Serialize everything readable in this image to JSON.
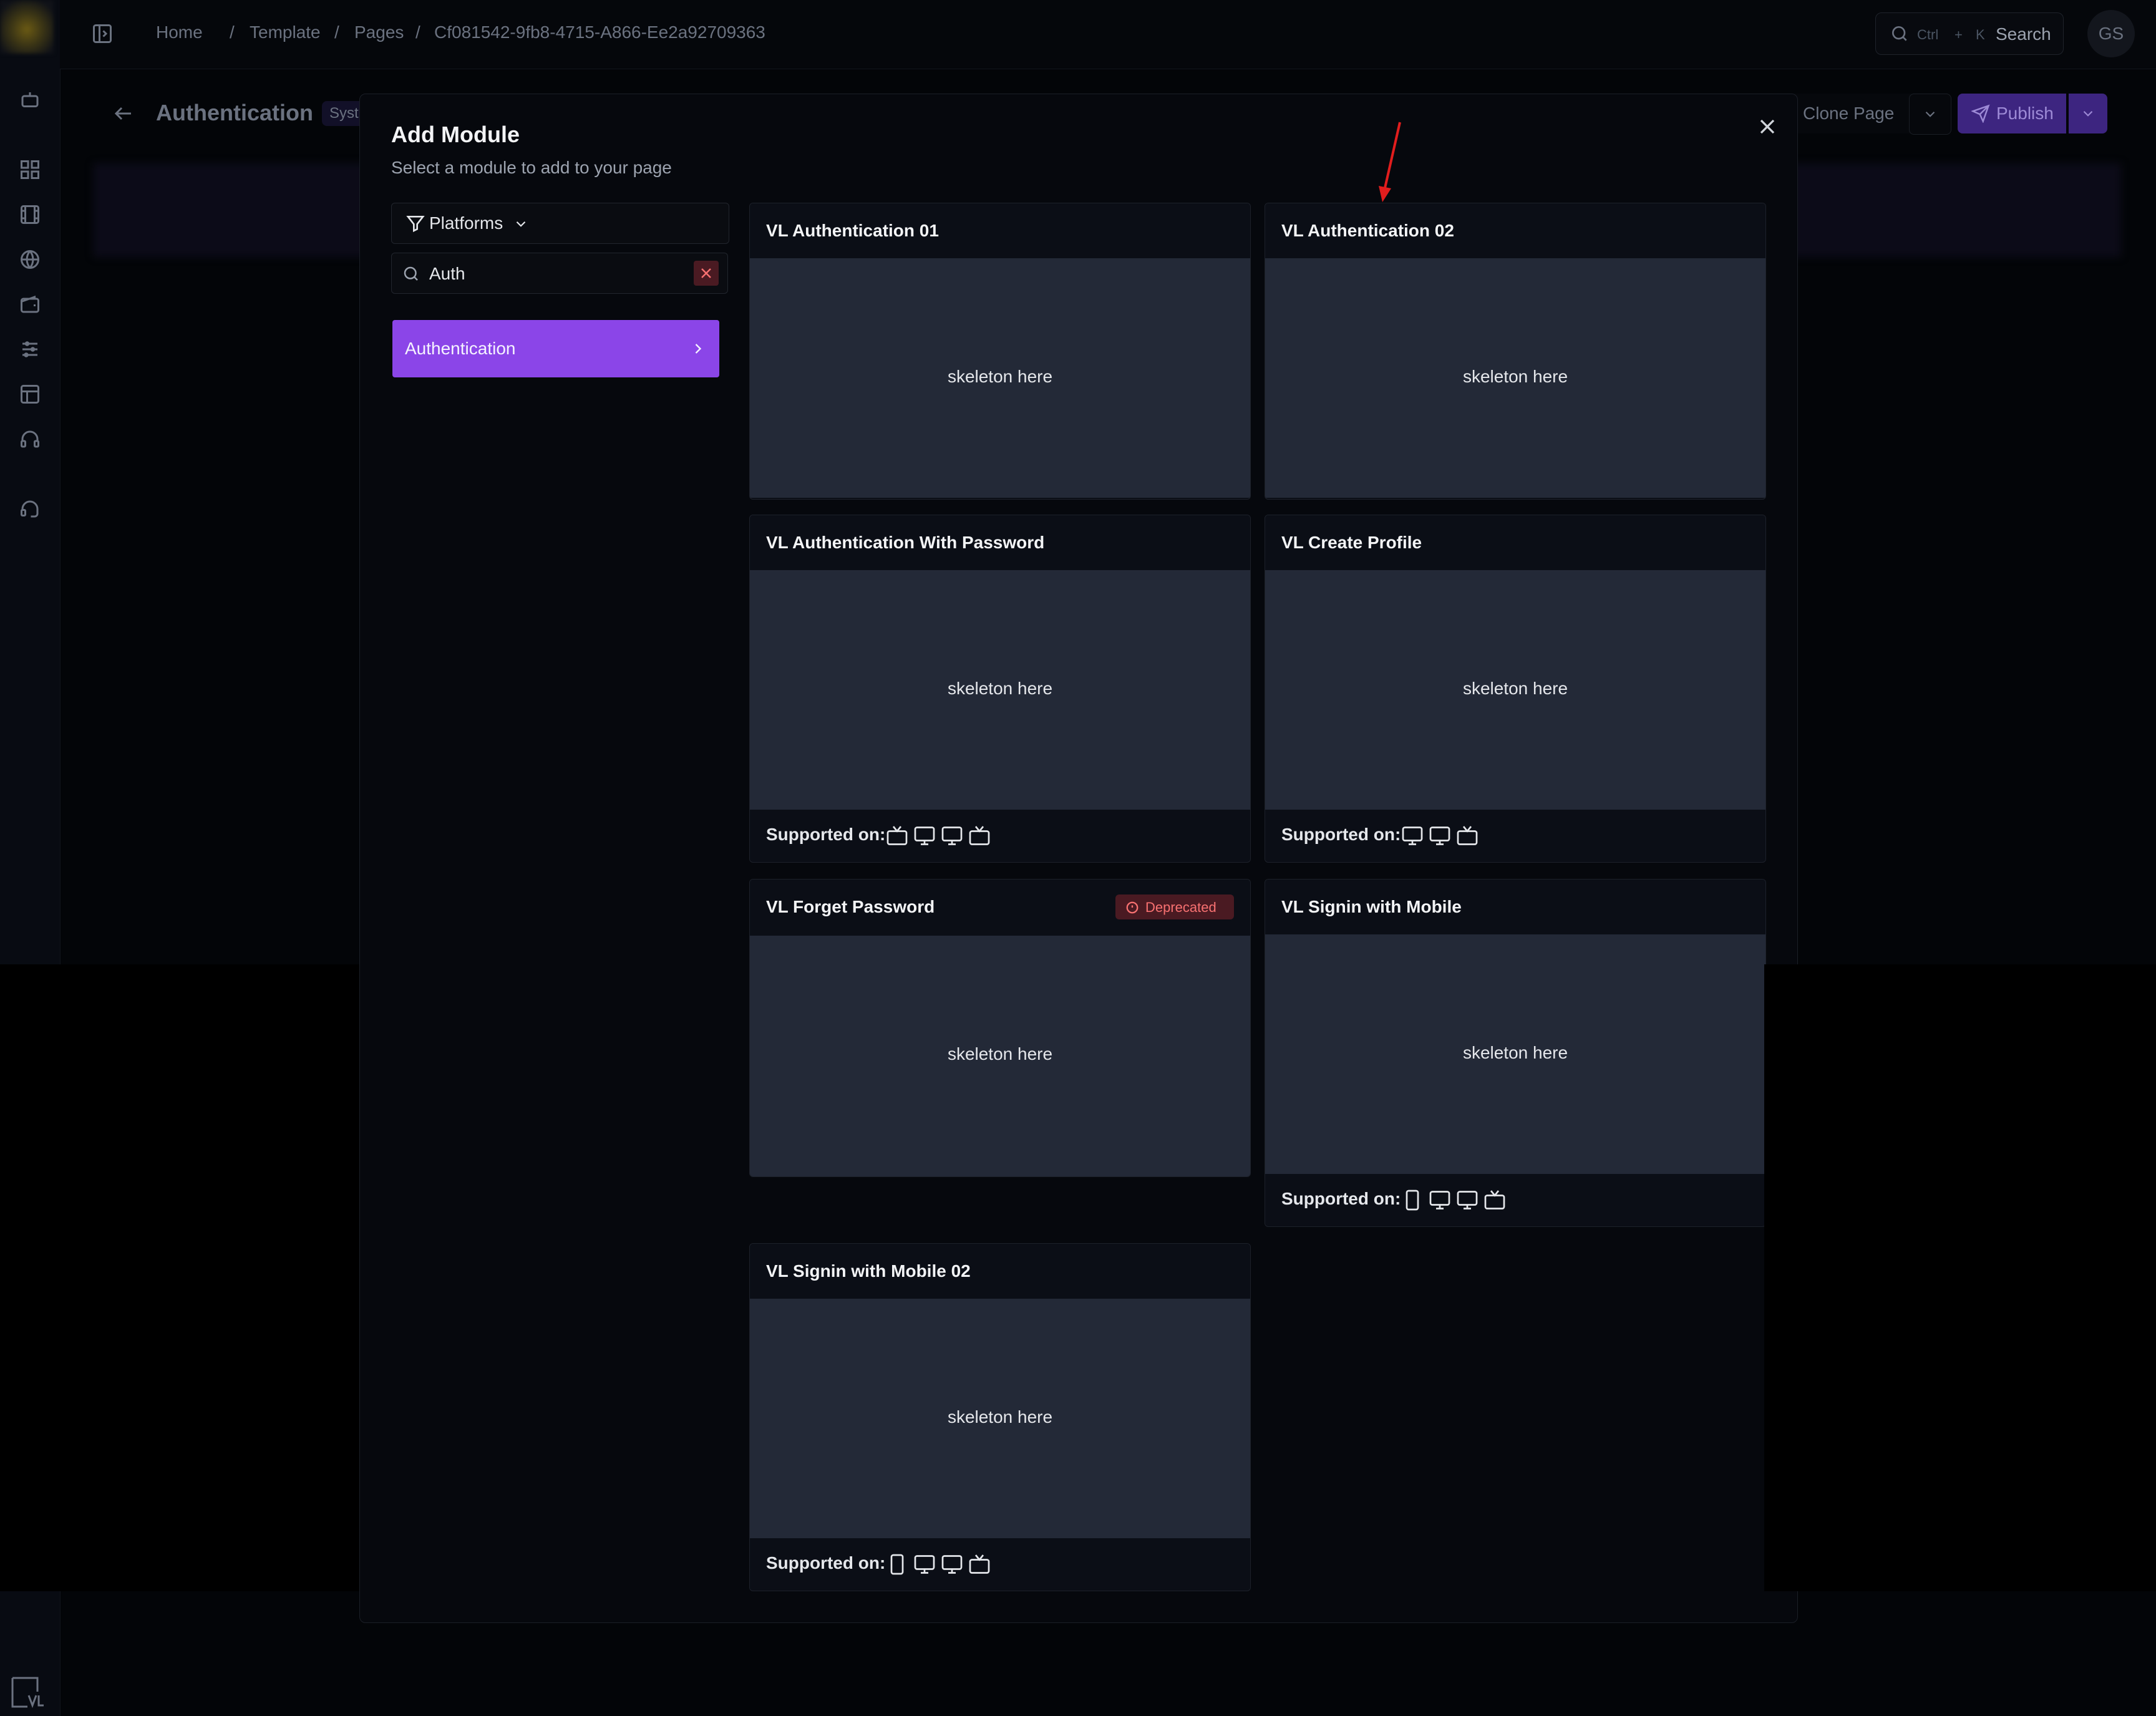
{
  "topbar": {
    "breadcrumbs": [
      "Home",
      "/",
      "Template",
      "/",
      "Pages",
      "/",
      "Cf081542-9fb8-4715-A866-Ee2a92709363"
    ],
    "search": {
      "kbd_ctrl": "Ctrl",
      "kbd_plus": "+",
      "kbd_k": "K",
      "label": "Search"
    },
    "avatar": "GS"
  },
  "page": {
    "title": "Authentication",
    "badge": "Syst",
    "clone_label": "Clone Page",
    "publish_label": "Publish"
  },
  "modal": {
    "title": "Add Module",
    "subtitle": "Select a module to add to your page",
    "platforms_label": "Platforms",
    "search_value": "Auth",
    "category": "Authentication",
    "cards": [
      {
        "title": "VL Authentication 01",
        "skeleton": "skeleton here"
      },
      {
        "title": "VL Authentication 02",
        "skeleton": "skeleton here"
      },
      {
        "title": "VL Authentication With Password",
        "skeleton": "skeleton here",
        "supported_label": "Supported on:",
        "platforms": [
          "tv-icon",
          "desktop-icon",
          "desktop-icon",
          "tv-icon"
        ]
      },
      {
        "title": "VL Create Profile",
        "skeleton": "skeleton here",
        "supported_label": "Supported on:",
        "platforms": [
          "desktop-icon",
          "desktop-icon",
          "tv-icon"
        ]
      },
      {
        "title": "VL Forget Password",
        "skeleton": "skeleton here",
        "badge": "Deprecated"
      },
      {
        "title": "VL Signin with Mobile",
        "skeleton": "skeleton here",
        "supported_label": "Supported on:",
        "platforms": [
          "mobile-icon",
          "desktop-icon",
          "desktop-icon",
          "tv-icon"
        ]
      },
      {
        "title": "VL Signin with Mobile 02",
        "skeleton": "skeleton here",
        "supported_label": "Supported on:",
        "platforms": [
          "mobile-icon",
          "desktop-icon",
          "desktop-icon",
          "tv-icon"
        ]
      }
    ]
  },
  "colors": {
    "accent": "#8b45e8",
    "publish": "#3d2580",
    "deprecated": "#f87171",
    "card_preview": "#232937",
    "background": "#030508"
  }
}
